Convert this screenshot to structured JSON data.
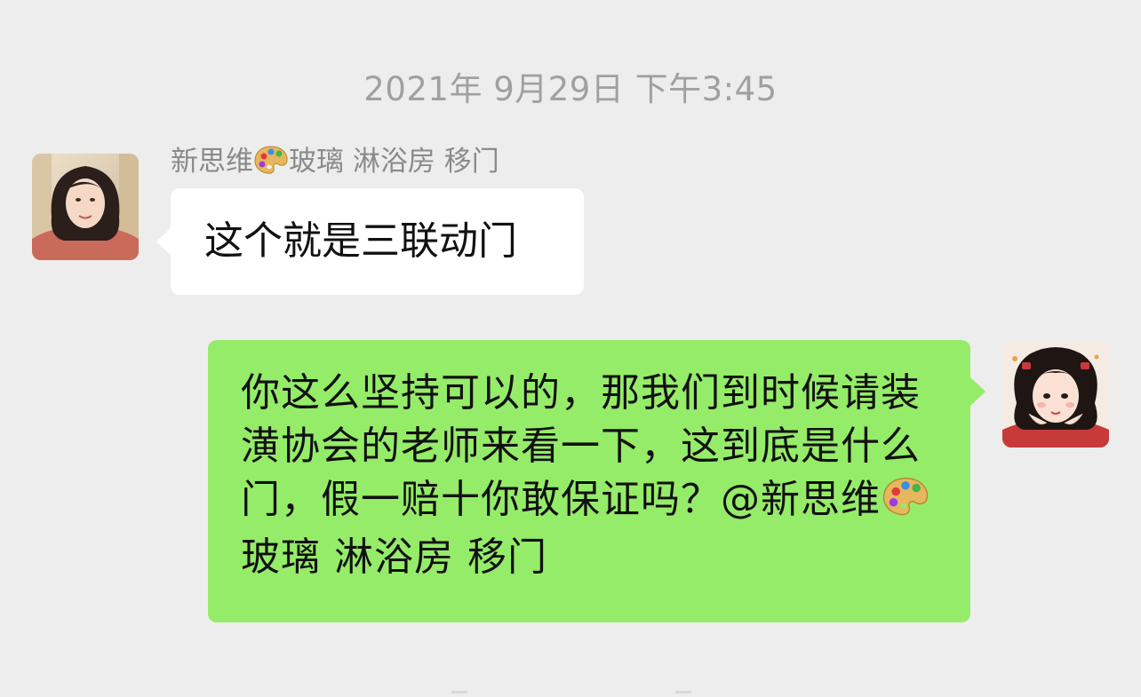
{
  "chat": {
    "timestamp": "2021年 9月29日 下午3:45",
    "messages": [
      {
        "side": "left",
        "sender_name_prefix": "新思维",
        "sender_name_emoji": "palette-emoji",
        "sender_name_suffix": "玻璃  淋浴房 移门",
        "text": "这个就是三联动门"
      },
      {
        "side": "right",
        "text_main": "你这么坚持可以的，那我们到时候请装潢协会的老师来看一下，这到底是什么门，假一赔十你敢保证吗？@新思维",
        "text_emoji": "palette-emoji",
        "text_suffix": "玻璃  淋浴房 移门"
      }
    ]
  },
  "colors": {
    "background": "#ededed",
    "incoming_bubble": "#ffffff",
    "outgoing_bubble": "#95ec69",
    "timestamp_text": "#a0a0a0",
    "sender_name_text": "#8a8a8a"
  }
}
